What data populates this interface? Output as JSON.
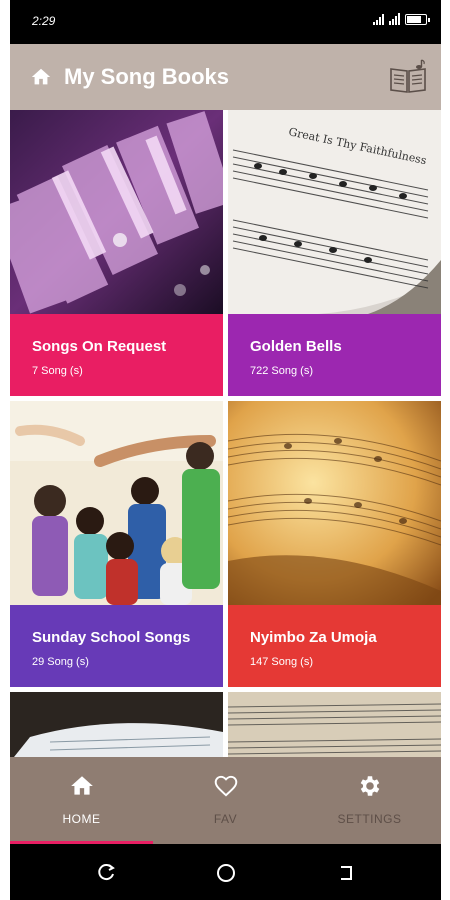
{
  "status_bar": {
    "time": "2:29"
  },
  "app_bar": {
    "title": "My Song Books",
    "home_icon": "home-icon",
    "action_icon": "songbook-icon"
  },
  "books": [
    {
      "title": "Songs On Request",
      "count": "7 Song (s)",
      "color": "#e91e63"
    },
    {
      "title": "Golden Bells",
      "count": "722 Song (s)",
      "color": "#9c27b0"
    },
    {
      "title": "Sunday School Songs",
      "count": "29 Song (s)",
      "color": "#673ab7"
    },
    {
      "title": "Nyimbo Za Umoja",
      "count": "147 Song (s)",
      "color": "#e53935"
    }
  ],
  "bottom_nav": [
    {
      "label": "HOME",
      "icon": "home-icon",
      "active": true
    },
    {
      "label": "FAV",
      "icon": "heart-icon",
      "active": false
    },
    {
      "label": "SETTINGS",
      "icon": "gear-icon",
      "active": false
    }
  ],
  "colors": {
    "app_bar": "#bfb2aa",
    "bottom_nav": "#8f7d72",
    "active_indicator": "#e91e63"
  }
}
